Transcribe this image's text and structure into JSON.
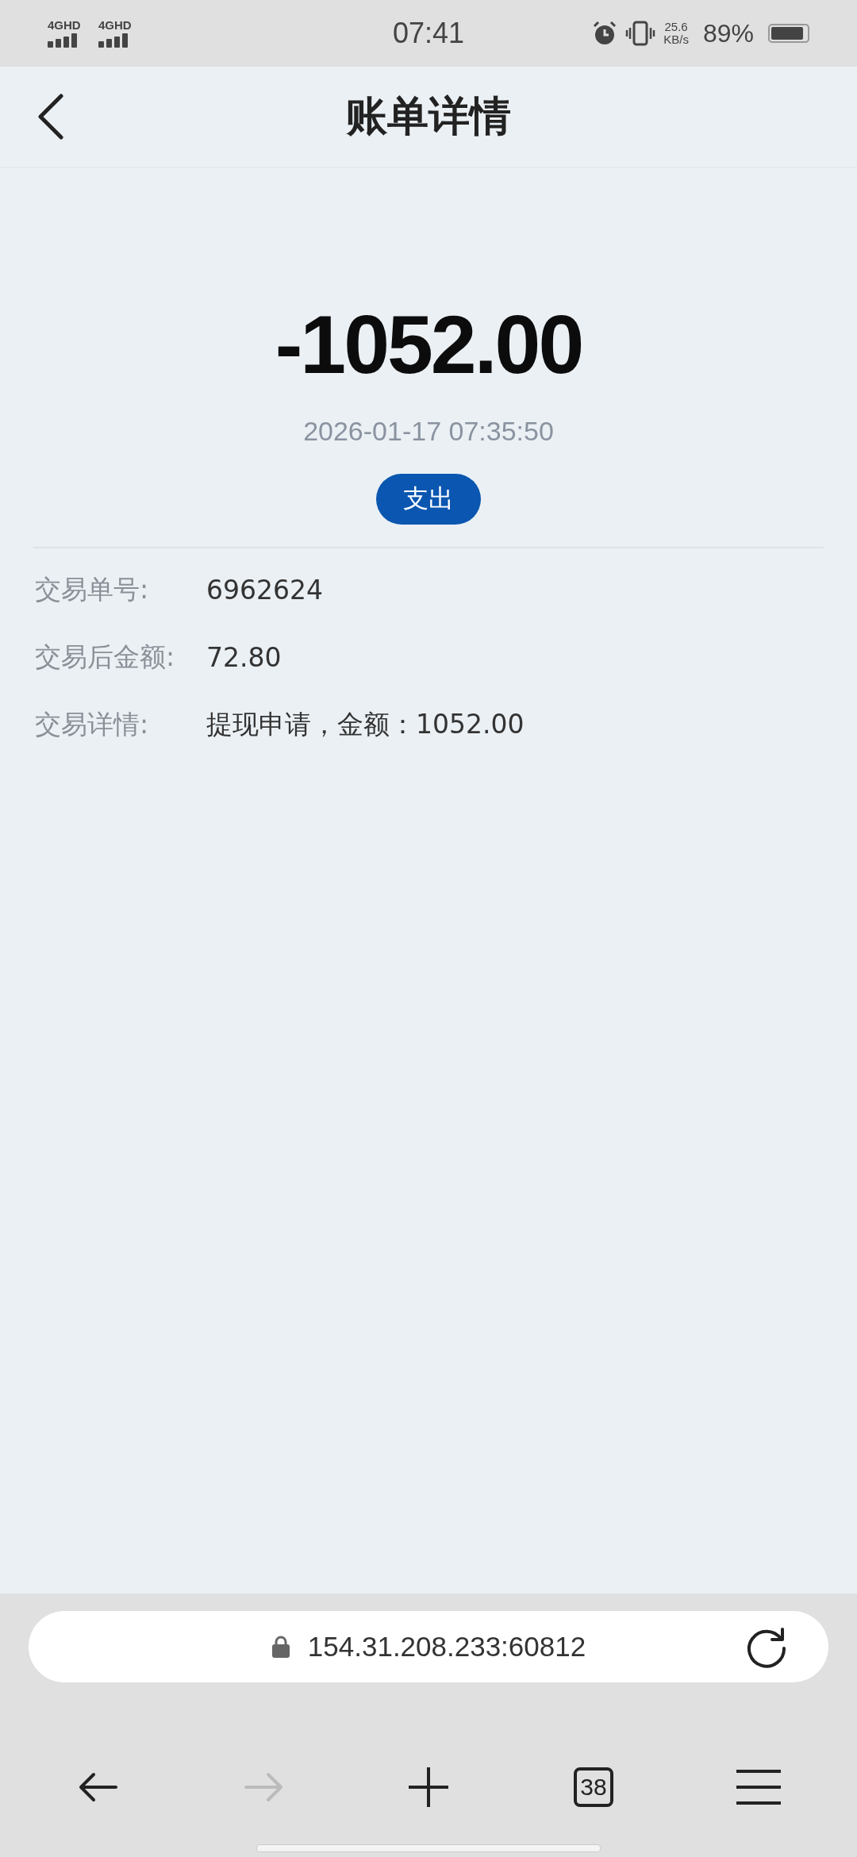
{
  "status_bar": {
    "signals": [
      "4GHD",
      "4GHD"
    ],
    "time": "07:41",
    "speed_value": "25.6",
    "speed_unit": "KB/s",
    "battery": "89%"
  },
  "header": {
    "title": "账单详情"
  },
  "summary": {
    "amount": "-1052.00",
    "datetime": "2026-01-17 07:35:50",
    "type_badge": "支出"
  },
  "details": [
    {
      "label": "交易单号:",
      "value": "6962624"
    },
    {
      "label": "交易后金额:",
      "value": "72.80"
    },
    {
      "label": "交易详情:",
      "value": "提现申请，金额：1052.00"
    }
  ],
  "browser": {
    "url": "154.31.208.233:60812",
    "toolbar": [
      {
        "kind": "back",
        "disabled": false
      },
      {
        "kind": "forward",
        "disabled": true
      },
      {
        "kind": "new-tab",
        "disabled": false
      },
      {
        "kind": "tabs",
        "label": "38",
        "disabled": false
      },
      {
        "kind": "menu",
        "disabled": false
      }
    ]
  }
}
